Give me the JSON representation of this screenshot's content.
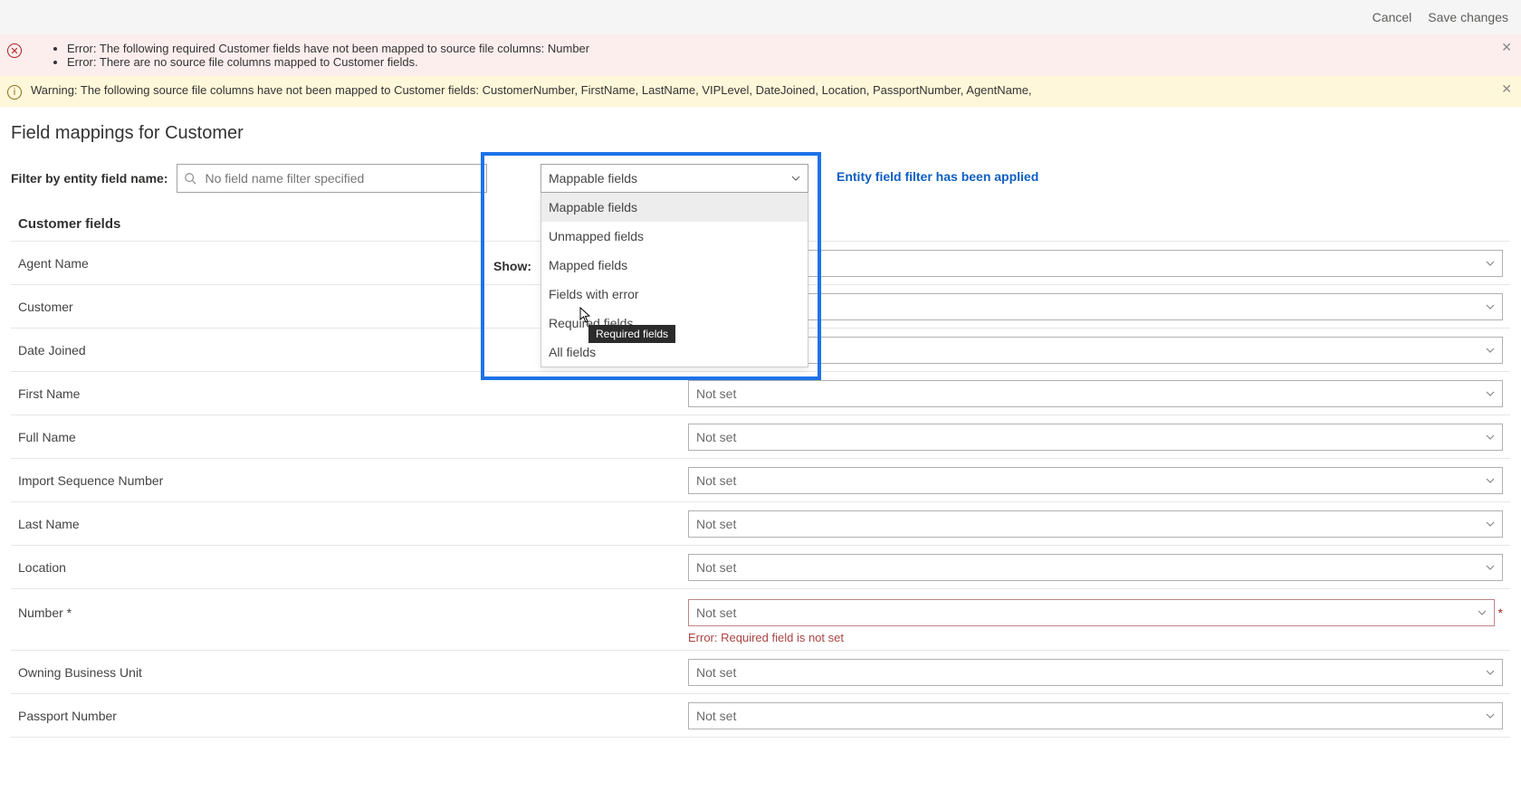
{
  "topbar": {
    "cancel": "Cancel",
    "save": "Save changes"
  },
  "alerts": {
    "error": {
      "line1": "Error: The following required Customer fields have not been mapped to source file columns: Number",
      "line2": "Error: There are no source file columns mapped to Customer fields."
    },
    "warn": "Warning: The following source file columns have not been mapped to Customer fields: CustomerNumber, FirstName, LastName, VIPLevel, DateJoined, Location, PassportNumber, AgentName,"
  },
  "page_title": "Field mappings for Customer",
  "filter": {
    "label": "Filter by entity field name:",
    "placeholder": "No field name filter specified"
  },
  "show": {
    "label": "Show:",
    "selected": "Mappable fields",
    "options": {
      "mappable": "Mappable fields",
      "unmapped": "Unmapped fields",
      "mapped": "Mapped fields",
      "with_error": "Fields with error",
      "required": "Required fields",
      "all": "All fields"
    },
    "tooltip": "Required fields"
  },
  "filter_applied": "Entity field filter has been applied",
  "columns": {
    "left": "Customer fields"
  },
  "not_set": "Not set",
  "fields": {
    "agent_name": "Agent Name",
    "customer": "Customer",
    "date_joined": "Date Joined",
    "first_name": "First Name",
    "full_name": "Full Name",
    "import_seq": "Import Sequence Number",
    "last_name": "Last Name",
    "location": "Location",
    "number": "Number *",
    "owning_bu": "Owning Business Unit",
    "passport": "Passport Number"
  },
  "number_error": "Error: Required field is not set"
}
